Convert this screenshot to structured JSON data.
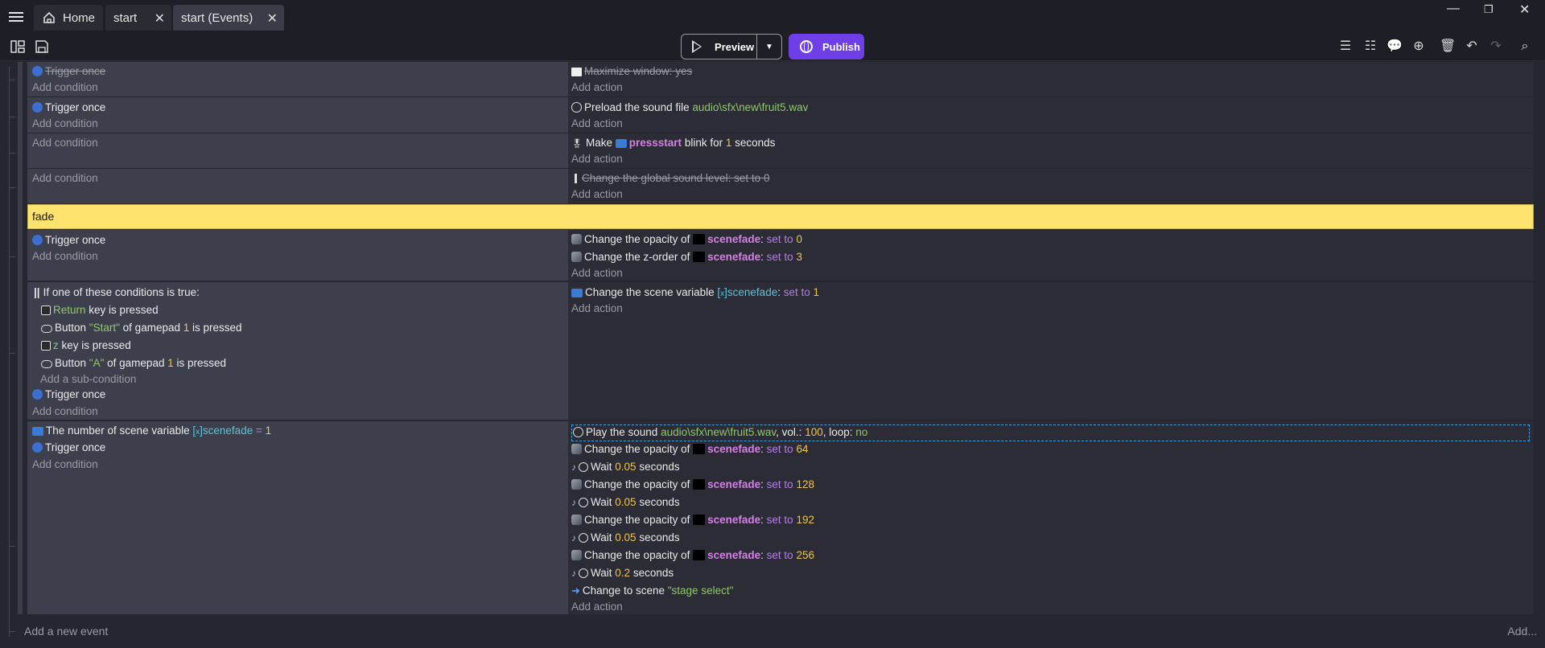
{
  "tabs": [
    {
      "label": "Home",
      "icon": "home-icon"
    },
    {
      "label": "start"
    },
    {
      "label": "start (Events)"
    }
  ],
  "toolbar": {
    "preview_label": "Preview",
    "publish_label": "Publish",
    "publish_color": "#6e3fe6"
  },
  "events": [
    {
      "conditions": [
        {
          "text": "Trigger once",
          "disabled": true
        }
      ],
      "add_condition": "Add condition",
      "actions": [
        {
          "html": "Maximize window: yes",
          "disabled": true
        }
      ],
      "add_action": "Add action"
    },
    {
      "conditions": [
        {
          "text": "Trigger once"
        }
      ],
      "add_condition": "Add condition",
      "actions": [
        {
          "text": "Preload the sound file",
          "arg": "audio\\sfx\\new\\fruit5.wav"
        }
      ],
      "add_action": "Add action"
    },
    {
      "add_condition": "Add condition",
      "actions": [
        {
          "pre": "Make",
          "object": "pressstart",
          "mid": "blink for",
          "num": "1",
          "post": "seconds"
        }
      ],
      "add_action": "Add action"
    },
    {
      "add_condition": "Add condition",
      "actions": [
        {
          "text": "Change the global sound level:",
          "op": "set to",
          "num": "0",
          "disabled": true
        }
      ],
      "add_action": "Add action"
    }
  ],
  "group": {
    "name": "fade",
    "color": "#ffe36f"
  },
  "event_fade_1": {
    "condition": "Trigger once",
    "add_condition": "Add condition",
    "action1": {
      "pre": "Change the opacity of",
      "object": "scenefade",
      "op": "set to",
      "num": "0"
    },
    "action2": {
      "pre": "Change the z-order of",
      "object": "scenefade",
      "op": "set to",
      "num": "3"
    },
    "add_action": "Add action"
  },
  "event_fade_2": {
    "or_label": "If one of these conditions is true:",
    "sub1": {
      "key": "Return",
      "post": "key is pressed"
    },
    "sub2": {
      "pre": "Button",
      "btn": "\"Start\"",
      "mid": "of gamepad",
      "num": "1",
      "post": "is pressed"
    },
    "sub3": {
      "key": "z",
      "post": "key is pressed"
    },
    "sub4": {
      "pre": "Button",
      "btn": "\"A\"",
      "mid": "of gamepad",
      "num": "1",
      "post": "is pressed"
    },
    "add_sub": "Add a sub-condition",
    "trigger": "Trigger once",
    "add_condition": "Add condition",
    "action": {
      "pre": "Change the scene variable",
      "var": "scenefade",
      "op": "set to",
      "num": "1"
    },
    "add_action": "Add action"
  },
  "event_fade_3": {
    "cond1": {
      "pre": "The number of scene variable",
      "var": "scenefade",
      "eq": "=",
      "num": "1"
    },
    "cond2": "Trigger once",
    "add_condition": "Add condition",
    "play": {
      "pre": "Play the sound",
      "file": "audio\\sfx\\new\\fruit5.wav",
      "vol_label": ", vol.:",
      "vol": "100",
      "loop_label": ", loop:",
      "loop": "no"
    },
    "opacity_pre": "Change the opacity of",
    "object": "scenefade",
    "op": "set to",
    "opacity_vals": [
      "64",
      "128",
      "192",
      "256"
    ],
    "wait_pre": "Wait",
    "wait_post": "seconds",
    "wait_vals": [
      "0.05",
      "0.05",
      "0.05",
      "0.2"
    ],
    "scene_change": {
      "pre": "Change to scene",
      "scene": "\"stage select\""
    },
    "add_action": "Add action"
  },
  "footer": {
    "add_event": "Add a new event",
    "add_more": "Add..."
  }
}
